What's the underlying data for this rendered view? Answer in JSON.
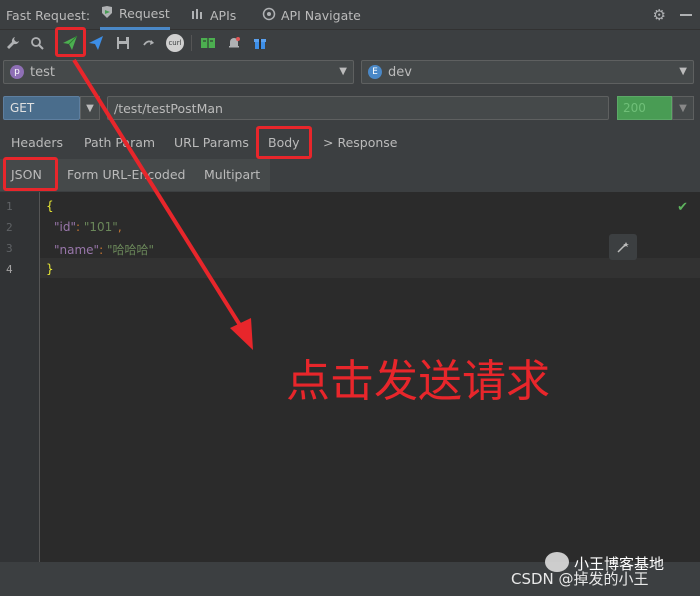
{
  "header": {
    "title": "Fast Request:",
    "tabs": [
      {
        "label": "Request",
        "icon": "fast-request-icon"
      },
      {
        "label": "APIs",
        "icon": "apis-icon"
      },
      {
        "label": "API Navigate",
        "icon": "navigate-icon"
      }
    ],
    "settings_icon": "gear-icon",
    "minimize_icon": "minus-icon"
  },
  "toolbar": {
    "icons": [
      "wrench-icon",
      "search-icon",
      "send-request-icon",
      "send-download-icon",
      "save-icon",
      "redo-icon",
      "curl-icon",
      "doc-icon",
      "notify-icon",
      "gift-icon"
    ],
    "curl_label": "curl"
  },
  "project": {
    "badge": "p",
    "value": "test"
  },
  "environment": {
    "badge": "E",
    "value": "dev"
  },
  "request": {
    "method": "GET",
    "url": "/test/testPostMan",
    "status": "200"
  },
  "subtabs": [
    "Headers",
    "Path Param",
    "URL Params",
    "Body",
    "> Response"
  ],
  "body_tabs": [
    "JSON",
    "Form URL-Encoded",
    "Multipart"
  ],
  "editor": {
    "line_numbers": [
      "1",
      "2",
      "3",
      "4"
    ],
    "lines": {
      "open": "{",
      "key1": "\"id\"",
      "val1": "\"101\"",
      "key2": "\"name\"",
      "val2": "\"哈哈哈\"",
      "close": "}"
    }
  },
  "annotation": {
    "text": "点击发送请求",
    "color": "#e8262b"
  },
  "watermark": {
    "line1": "小王博客基地",
    "line2": "CSDN @掉发的小王"
  },
  "colors": {
    "accent": "#4a88c7",
    "status_ok": "#499c54",
    "highlight": "#e8262b"
  }
}
